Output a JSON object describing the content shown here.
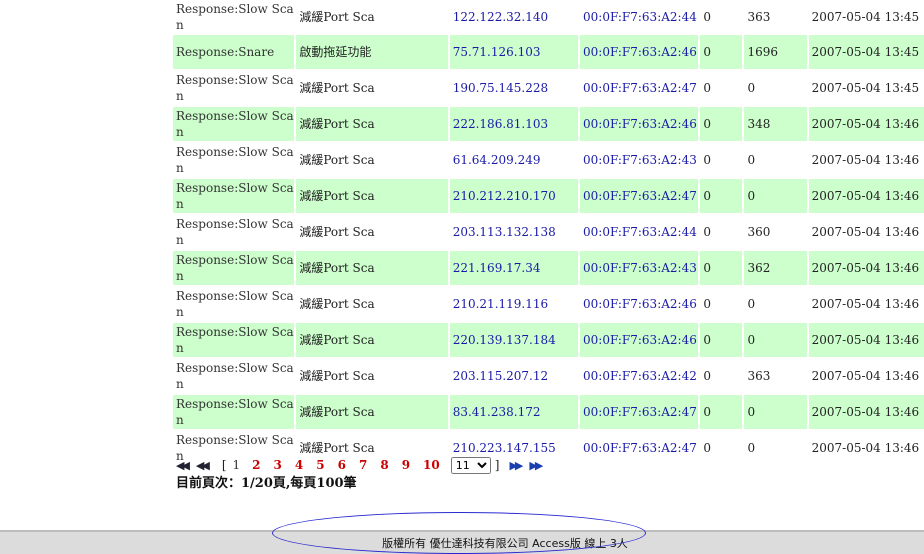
{
  "table": {
    "rows": [
      {
        "type": "Response:Slow Scan",
        "action": "減緩Port Sca",
        "ip": "122.122.32.140",
        "mac": "00:0F:F7:63:A2:44",
        "col5": "0",
        "col6": "363",
        "time": "2007-05-04 13:45"
      },
      {
        "type": "Response:Snare",
        "action": "啟動拖延功能",
        "ip": "75.71.126.103",
        "mac": "00:0F:F7:63:A2:46",
        "col5": "0",
        "col6": "1696",
        "time": "2007-05-04 13:45"
      },
      {
        "type": "Response:Slow Scan",
        "action": "減緩Port Sca",
        "ip": "190.75.145.228",
        "mac": "00:0F:F7:63:A2:47",
        "col5": "0",
        "col6": "0",
        "time": "2007-05-04 13:45"
      },
      {
        "type": "Response:Slow Scan",
        "action": "減緩Port Sca",
        "ip": "222.186.81.103",
        "mac": "00:0F:F7:63:A2:46",
        "col5": "0",
        "col6": "348",
        "time": "2007-05-04 13:46"
      },
      {
        "type": "Response:Slow Scan",
        "action": "減緩Port Sca",
        "ip": "61.64.209.249",
        "mac": "00:0F:F7:63:A2:43",
        "col5": "0",
        "col6": "0",
        "time": "2007-05-04 13:46"
      },
      {
        "type": "Response:Slow Scan",
        "action": "減緩Port Sca",
        "ip": "210.212.210.170",
        "mac": "00:0F:F7:63:A2:47",
        "col5": "0",
        "col6": "0",
        "time": "2007-05-04 13:46"
      },
      {
        "type": "Response:Slow Scan",
        "action": "減緩Port Sca",
        "ip": "203.113.132.138",
        "mac": "00:0F:F7:63:A2:44",
        "col5": "0",
        "col6": "360",
        "time": "2007-05-04 13:46"
      },
      {
        "type": "Response:Slow Scan",
        "action": "減緩Port Sca",
        "ip": "221.169.17.34",
        "mac": "00:0F:F7:63:A2:43",
        "col5": "0",
        "col6": "362",
        "time": "2007-05-04 13:46"
      },
      {
        "type": "Response:Slow Scan",
        "action": "減緩Port Sca",
        "ip": "210.21.119.116",
        "mac": "00:0F:F7:63:A2:46",
        "col5": "0",
        "col6": "0",
        "time": "2007-05-04 13:46"
      },
      {
        "type": "Response:Slow Scan",
        "action": "減緩Port Sca",
        "ip": "220.139.137.184",
        "mac": "00:0F:F7:63:A2:46",
        "col5": "0",
        "col6": "0",
        "time": "2007-05-04 13:46"
      },
      {
        "type": "Response:Slow Scan",
        "action": "減緩Port Sca",
        "ip": "203.115.207.12",
        "mac": "00:0F:F7:63:A2:42",
        "col5": "0",
        "col6": "363",
        "time": "2007-05-04 13:46"
      },
      {
        "type": "Response:Slow Scan",
        "action": "減緩Port Sca",
        "ip": "83.41.238.172",
        "mac": "00:0F:F7:63:A2:47",
        "col5": "0",
        "col6": "0",
        "time": "2007-05-04 13:46"
      },
      {
        "type": "Response:Slow Scan",
        "action": "減緩Port Sca",
        "ip": "210.223.147.155",
        "mac": "00:0F:F7:63:A2:47",
        "col5": "0",
        "col6": "0",
        "time": "2007-05-04 13:46"
      }
    ]
  },
  "pager": {
    "first_icon": "first-page-icon",
    "prev_icon": "prev-page-icon",
    "next_icon": "next-page-icon",
    "last_icon": "last-page-icon",
    "open_bracket": "[",
    "close_bracket": "]",
    "current_page": "1",
    "pages": [
      "2",
      "3",
      "4",
      "5",
      "6",
      "7",
      "8",
      "9",
      "10"
    ],
    "select_value": "11",
    "select_options": [
      "11"
    ],
    "status": "目前頁次：1/20頁,每頁100筆"
  },
  "footer": {
    "text": "版權所有 優仕達科技有限公司 Access版 線上 3人"
  },
  "colors": {
    "alt_row": "#ccffcc",
    "link_blue": "#1a1aa8",
    "page_link_red": "#cc0000",
    "annotation_ellipse": "#2a2ad0"
  }
}
